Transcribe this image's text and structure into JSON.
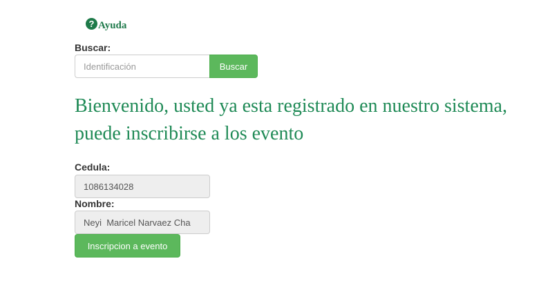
{
  "help": {
    "label": "Ayuda",
    "icon": "question-circle-icon",
    "color": "#1f7a4b"
  },
  "search": {
    "label": "Buscar:",
    "placeholder": "Identificación",
    "button_label": "Buscar"
  },
  "welcome_message": "Bienvenido, usted ya esta registrado en nuestro sistema, puede inscribirse a los evento",
  "form": {
    "cedula_label": "Cedula:",
    "cedula_value": "1086134028",
    "nombre_label": "Nombre:",
    "nombre_value": "Neyi  Maricel Narvaez Cha",
    "submit_label": "Inscripcion a evento"
  },
  "colors": {
    "accent_green": "#5cb85c",
    "heading_green": "#1f8a56"
  }
}
